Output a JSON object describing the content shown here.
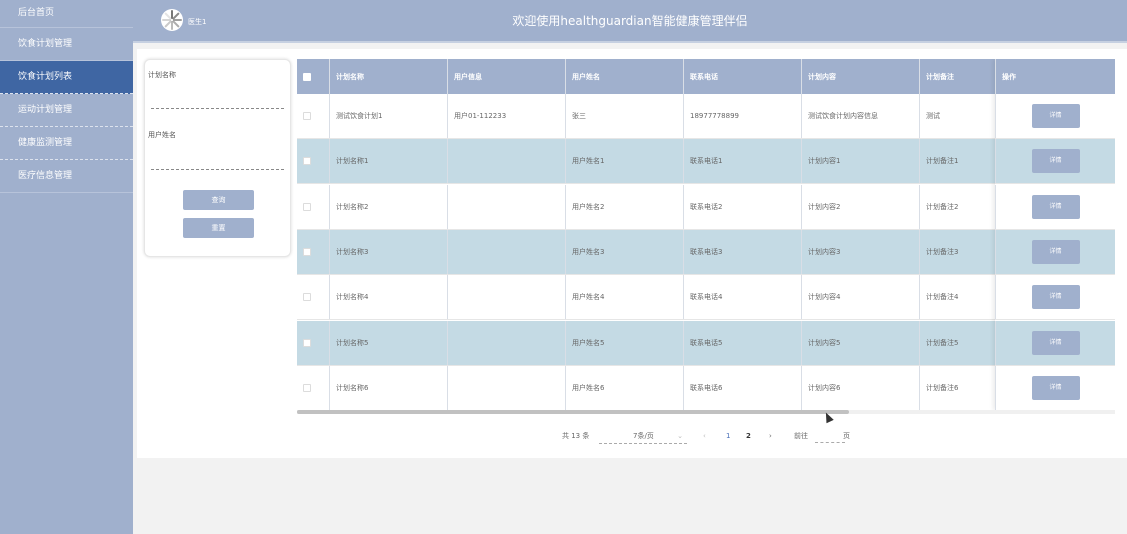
{
  "sidebar": {
    "items": [
      {
        "label": "后台首页"
      },
      {
        "label": "饮食计划管理"
      },
      {
        "label": "饮食计划列表"
      },
      {
        "label": "运动计划管理"
      },
      {
        "label": "健康监测管理"
      },
      {
        "label": "医疗信息管理"
      }
    ]
  },
  "header": {
    "user": "医生1",
    "title": "欢迎使用healthguardian智能健康管理伴侣"
  },
  "search": {
    "plan_name_label": "计划名称",
    "user_name_label": "用户姓名",
    "query_button": "查询",
    "reset_button": "重置"
  },
  "table": {
    "headers": [
      "计划名称",
      "用户信息",
      "用户姓名",
      "联系电话",
      "计划内容",
      "计划备注",
      "操作"
    ],
    "detail_label": "详情",
    "rows": [
      {
        "plan": "测试饮食计划1",
        "info": "用户01-112233",
        "name": "张三",
        "phone": "18977778899",
        "content": "测试饮食计划内容信息",
        "note": "测试"
      },
      {
        "plan": "计划名称1",
        "info": "",
        "name": "用户姓名1",
        "phone": "联系电话1",
        "content": "计划内容1",
        "note": "计划备注1"
      },
      {
        "plan": "计划名称2",
        "info": "",
        "name": "用户姓名2",
        "phone": "联系电话2",
        "content": "计划内容2",
        "note": "计划备注2"
      },
      {
        "plan": "计划名称3",
        "info": "",
        "name": "用户姓名3",
        "phone": "联系电话3",
        "content": "计划内容3",
        "note": "计划备注3"
      },
      {
        "plan": "计划名称4",
        "info": "",
        "name": "用户姓名4",
        "phone": "联系电话4",
        "content": "计划内容4",
        "note": "计划备注4"
      },
      {
        "plan": "计划名称5",
        "info": "",
        "name": "用户姓名5",
        "phone": "联系电话5",
        "content": "计划内容5",
        "note": "计划备注5"
      },
      {
        "plan": "计划名称6",
        "info": "",
        "name": "用户姓名6",
        "phone": "联系电话6",
        "content": "计划内容6",
        "note": "计划备注6"
      }
    ]
  },
  "pagination": {
    "total": "共 13 条",
    "page_size": "7条/页",
    "prev": "‹",
    "pages": [
      "1",
      "2"
    ],
    "next": "›",
    "goto_label": "前往",
    "page_suffix": "页"
  }
}
